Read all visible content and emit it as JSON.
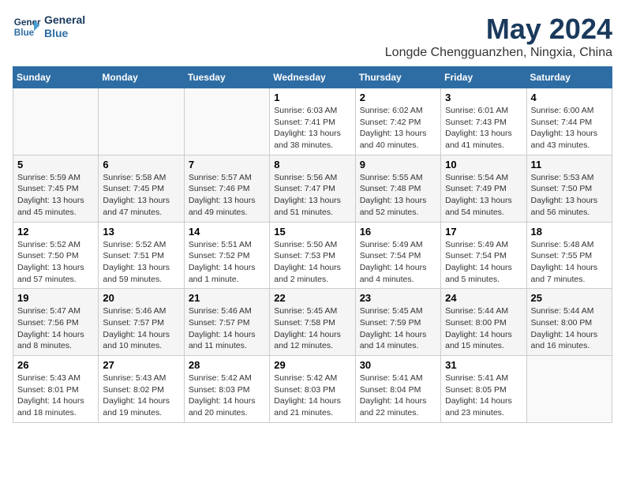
{
  "header": {
    "logo_line1": "General",
    "logo_line2": "Blue",
    "month": "May 2024",
    "location": "Longde Chengguanzhen, Ningxia, China"
  },
  "weekdays": [
    "Sunday",
    "Monday",
    "Tuesday",
    "Wednesday",
    "Thursday",
    "Friday",
    "Saturday"
  ],
  "weeks": [
    [
      {
        "day": "",
        "info": ""
      },
      {
        "day": "",
        "info": ""
      },
      {
        "day": "",
        "info": ""
      },
      {
        "day": "1",
        "info": "Sunrise: 6:03 AM\nSunset: 7:41 PM\nDaylight: 13 hours\nand 38 minutes."
      },
      {
        "day": "2",
        "info": "Sunrise: 6:02 AM\nSunset: 7:42 PM\nDaylight: 13 hours\nand 40 minutes."
      },
      {
        "day": "3",
        "info": "Sunrise: 6:01 AM\nSunset: 7:43 PM\nDaylight: 13 hours\nand 41 minutes."
      },
      {
        "day": "4",
        "info": "Sunrise: 6:00 AM\nSunset: 7:44 PM\nDaylight: 13 hours\nand 43 minutes."
      }
    ],
    [
      {
        "day": "5",
        "info": "Sunrise: 5:59 AM\nSunset: 7:45 PM\nDaylight: 13 hours\nand 45 minutes."
      },
      {
        "day": "6",
        "info": "Sunrise: 5:58 AM\nSunset: 7:45 PM\nDaylight: 13 hours\nand 47 minutes."
      },
      {
        "day": "7",
        "info": "Sunrise: 5:57 AM\nSunset: 7:46 PM\nDaylight: 13 hours\nand 49 minutes."
      },
      {
        "day": "8",
        "info": "Sunrise: 5:56 AM\nSunset: 7:47 PM\nDaylight: 13 hours\nand 51 minutes."
      },
      {
        "day": "9",
        "info": "Sunrise: 5:55 AM\nSunset: 7:48 PM\nDaylight: 13 hours\nand 52 minutes."
      },
      {
        "day": "10",
        "info": "Sunrise: 5:54 AM\nSunset: 7:49 PM\nDaylight: 13 hours\nand 54 minutes."
      },
      {
        "day": "11",
        "info": "Sunrise: 5:53 AM\nSunset: 7:50 PM\nDaylight: 13 hours\nand 56 minutes."
      }
    ],
    [
      {
        "day": "12",
        "info": "Sunrise: 5:52 AM\nSunset: 7:50 PM\nDaylight: 13 hours\nand 57 minutes."
      },
      {
        "day": "13",
        "info": "Sunrise: 5:52 AM\nSunset: 7:51 PM\nDaylight: 13 hours\nand 59 minutes."
      },
      {
        "day": "14",
        "info": "Sunrise: 5:51 AM\nSunset: 7:52 PM\nDaylight: 14 hours\nand 1 minute."
      },
      {
        "day": "15",
        "info": "Sunrise: 5:50 AM\nSunset: 7:53 PM\nDaylight: 14 hours\nand 2 minutes."
      },
      {
        "day": "16",
        "info": "Sunrise: 5:49 AM\nSunset: 7:54 PM\nDaylight: 14 hours\nand 4 minutes."
      },
      {
        "day": "17",
        "info": "Sunrise: 5:49 AM\nSunset: 7:54 PM\nDaylight: 14 hours\nand 5 minutes."
      },
      {
        "day": "18",
        "info": "Sunrise: 5:48 AM\nSunset: 7:55 PM\nDaylight: 14 hours\nand 7 minutes."
      }
    ],
    [
      {
        "day": "19",
        "info": "Sunrise: 5:47 AM\nSunset: 7:56 PM\nDaylight: 14 hours\nand 8 minutes."
      },
      {
        "day": "20",
        "info": "Sunrise: 5:46 AM\nSunset: 7:57 PM\nDaylight: 14 hours\nand 10 minutes."
      },
      {
        "day": "21",
        "info": "Sunrise: 5:46 AM\nSunset: 7:57 PM\nDaylight: 14 hours\nand 11 minutes."
      },
      {
        "day": "22",
        "info": "Sunrise: 5:45 AM\nSunset: 7:58 PM\nDaylight: 14 hours\nand 12 minutes."
      },
      {
        "day": "23",
        "info": "Sunrise: 5:45 AM\nSunset: 7:59 PM\nDaylight: 14 hours\nand 14 minutes."
      },
      {
        "day": "24",
        "info": "Sunrise: 5:44 AM\nSunset: 8:00 PM\nDaylight: 14 hours\nand 15 minutes."
      },
      {
        "day": "25",
        "info": "Sunrise: 5:44 AM\nSunset: 8:00 PM\nDaylight: 14 hours\nand 16 minutes."
      }
    ],
    [
      {
        "day": "26",
        "info": "Sunrise: 5:43 AM\nSunset: 8:01 PM\nDaylight: 14 hours\nand 18 minutes."
      },
      {
        "day": "27",
        "info": "Sunrise: 5:43 AM\nSunset: 8:02 PM\nDaylight: 14 hours\nand 19 minutes."
      },
      {
        "day": "28",
        "info": "Sunrise: 5:42 AM\nSunset: 8:03 PM\nDaylight: 14 hours\nand 20 minutes."
      },
      {
        "day": "29",
        "info": "Sunrise: 5:42 AM\nSunset: 8:03 PM\nDaylight: 14 hours\nand 21 minutes."
      },
      {
        "day": "30",
        "info": "Sunrise: 5:41 AM\nSunset: 8:04 PM\nDaylight: 14 hours\nand 22 minutes."
      },
      {
        "day": "31",
        "info": "Sunrise: 5:41 AM\nSunset: 8:05 PM\nDaylight: 14 hours\nand 23 minutes."
      },
      {
        "day": "",
        "info": ""
      }
    ]
  ]
}
